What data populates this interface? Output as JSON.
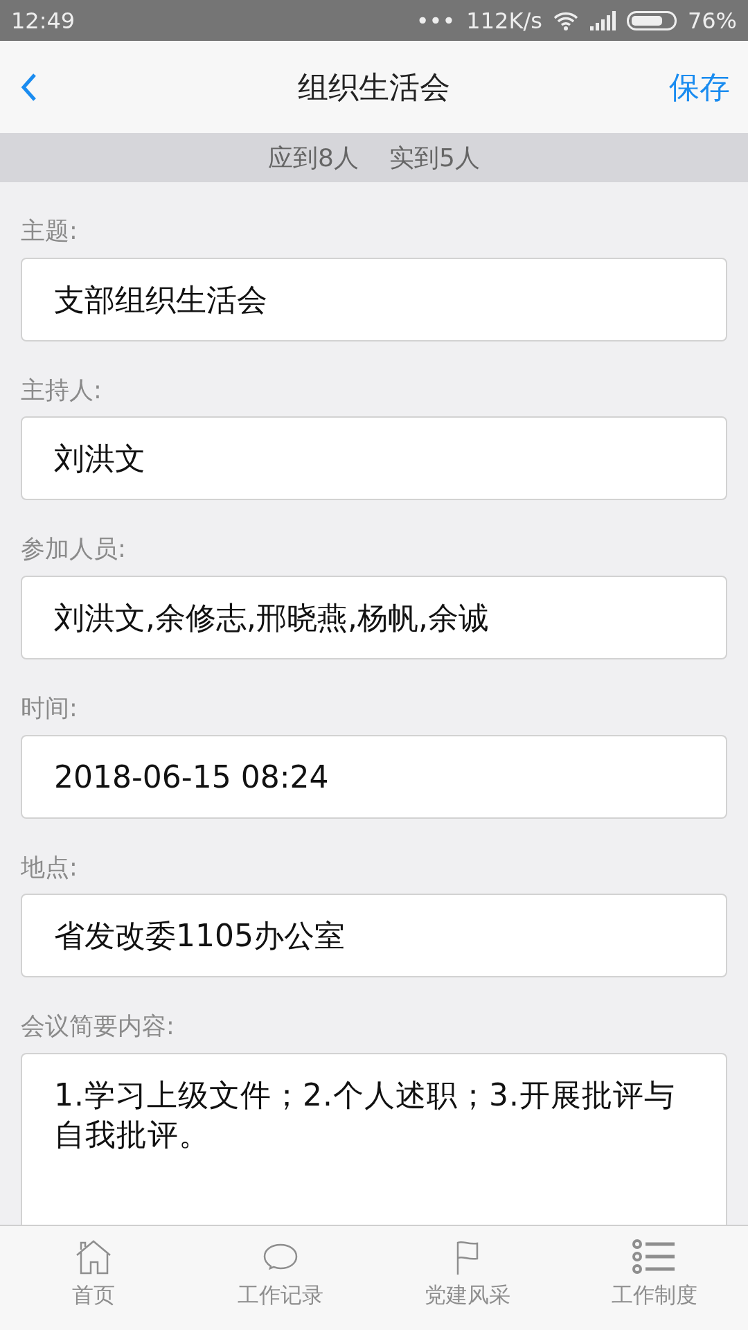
{
  "status_bar": {
    "time": "12:49",
    "dots": "•••",
    "speed": "112K/s",
    "battery": "76%"
  },
  "header": {
    "title": "组织生活会",
    "action": "保存"
  },
  "attendance": [
    "应到8人",
    "实到5人"
  ],
  "fields": [
    {
      "label": "主题:",
      "value": "支部组织生活会",
      "kind": "input"
    },
    {
      "label": "主持人:",
      "value": "刘洪文",
      "kind": "input"
    },
    {
      "label": "参加人员:",
      "value": "刘洪文,余修志,邢晓燕,杨帆,余诚",
      "kind": "input"
    },
    {
      "label": "时间:",
      "value": "2018-06-15 08:24",
      "kind": "input"
    },
    {
      "label": "地点:",
      "value": "省发改委1105办公室",
      "kind": "input"
    },
    {
      "label": "会议简要内容:",
      "value": "1.学习上级文件；2.个人述职；3.开展批评与自我批评。",
      "kind": "textarea"
    }
  ],
  "tabs": [
    {
      "label": "首页",
      "kind": "home",
      "selected": false
    },
    {
      "label": "工作记录",
      "kind": "chat",
      "selected": false
    },
    {
      "label": "党建风采",
      "kind": "flag",
      "selected": false
    },
    {
      "label": "工作制度",
      "kind": "list",
      "selected": false
    }
  ]
}
